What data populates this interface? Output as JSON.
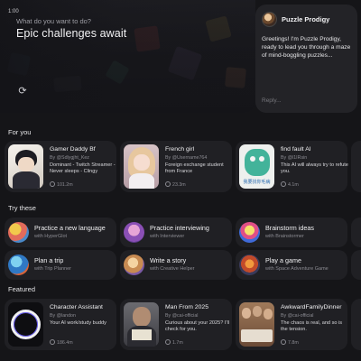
{
  "hero": {
    "time": "1:00",
    "question": "What do you want to do?",
    "title": "Epic challenges await"
  },
  "chat_preview": {
    "name": "Puzzle Prodigy",
    "message": "Greetings! I'm Puzzle Prodigy, ready to lead you through a maze of mind-boggling puzzles...",
    "reply_placeholder": "Reply..."
  },
  "sections": {
    "for_you": "For you",
    "try_these": "Try these",
    "featured": "Featured"
  },
  "for_you": [
    {
      "title": "Gamer Daddy Bf",
      "by": "By @Sdlygjht_Kez",
      "desc": "Dominant - Twitch Streamer - Never sleeps - Clingy",
      "count": "101.2m"
    },
    {
      "title": "French girl",
      "by": "By @Username764",
      "desc": "Foreign exchange student from France",
      "count": "23.3m"
    },
    {
      "title": "find fault AI",
      "by": "By @l1IRsin",
      "desc": "This AI will always try to refute you.",
      "count": "4.1m"
    }
  ],
  "try_these": [
    {
      "title": "Practice a new language",
      "sub": "with HyperGlot"
    },
    {
      "title": "Practice interviewing",
      "sub": "with Interviewer"
    },
    {
      "title": "Brainstorm ideas",
      "sub": "with Brainstormer"
    },
    {
      "title": "Plan a trip",
      "sub": "with Trip Planner"
    },
    {
      "title": "Write a story",
      "sub": "with Creative Helper"
    },
    {
      "title": "Play a game",
      "sub": "with Space Adventure Game"
    }
  ],
  "featured": [
    {
      "title": "Character Assistant",
      "by": "By @landon",
      "desc": "Your AI work/study buddy",
      "count": "186.4m"
    },
    {
      "title": "Man From 2025",
      "by": "By @cai-official",
      "desc": "Curious about your 2025? I'll check for you.",
      "count": "1.7m"
    },
    {
      "title": "AwkwardFamilyDinner",
      "by": "By @cai-official",
      "desc": "The chaos is real, and so is the tension.",
      "count": "7.8m"
    }
  ],
  "thumb_text": {
    "french": "",
    "fault": "我要找你毛病"
  },
  "icons": {
    "refresh": "refresh-icon",
    "count": "chat-count-icon"
  },
  "colors": {
    "background": "#151518",
    "card": "#202024",
    "muted": "#8b8b92"
  }
}
